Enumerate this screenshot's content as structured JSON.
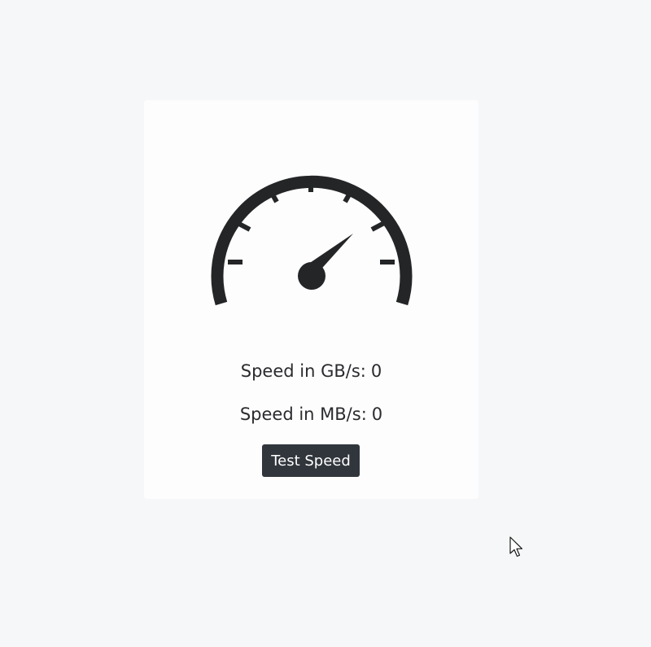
{
  "gauge": {
    "icon": "speedometer-icon",
    "color": "#242527"
  },
  "speed": {
    "gb_label": "Speed in GB/s:",
    "gb_value": "0",
    "mb_label": "Speed in MB/s:",
    "mb_value": "0"
  },
  "actions": {
    "test_label": "Test Speed"
  },
  "colors": {
    "background": "#f6f7f9",
    "card": "#fdfdfd",
    "button": "#31363c",
    "text": "#2a2b2e"
  }
}
